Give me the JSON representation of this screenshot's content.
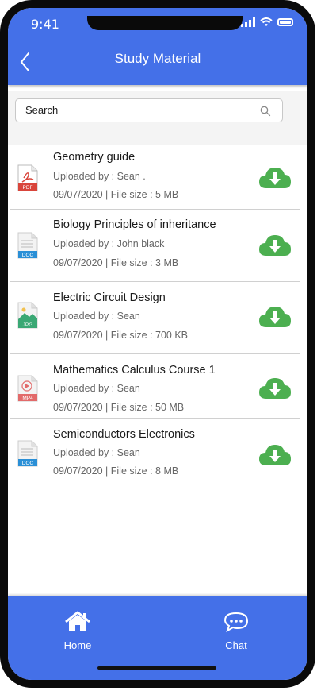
{
  "status_bar": {
    "time": "9:41"
  },
  "header": {
    "title": "Study Material",
    "back_icon": "chevron-left-icon"
  },
  "search": {
    "placeholder": "Search",
    "value": "",
    "icon": "search-icon"
  },
  "files": [
    {
      "name": "Geometry guide",
      "uploader": "Uploaded by : Sean .",
      "meta": "09/07/2020  |  File size : 5 MB",
      "type": "PDF",
      "type_color": "#d9453b"
    },
    {
      "name": "Biology Principles of inheritance",
      "uploader": "Uploaded by : John black",
      "meta": "09/07/2020  |  File size : 3 MB",
      "type": "DOC",
      "type_color": "#2a8fd6"
    },
    {
      "name": "Electric Circuit Design",
      "uploader": "Uploaded by : Sean",
      "meta": "09/07/2020  |  File size : 700 KB",
      "type": "JPG",
      "type_color": "#3aa874"
    },
    {
      "name": "Mathematics Calculus Course 1",
      "uploader": "Uploaded by : Sean",
      "meta": "09/07/2020  |  File size : 50 MB",
      "type": "MP4",
      "type_color": "#e26a6a"
    },
    {
      "name": "Semiconductors Electronics",
      "uploader": "Uploaded by : Sean",
      "meta": "09/07/2020  |  File size : 8 MB",
      "type": "DOC",
      "type_color": "#2a8fd6"
    }
  ],
  "download_color": "#4caf50",
  "nav": {
    "home_label": "Home",
    "chat_label": "Chat"
  },
  "colors": {
    "primary": "#4470e8"
  }
}
